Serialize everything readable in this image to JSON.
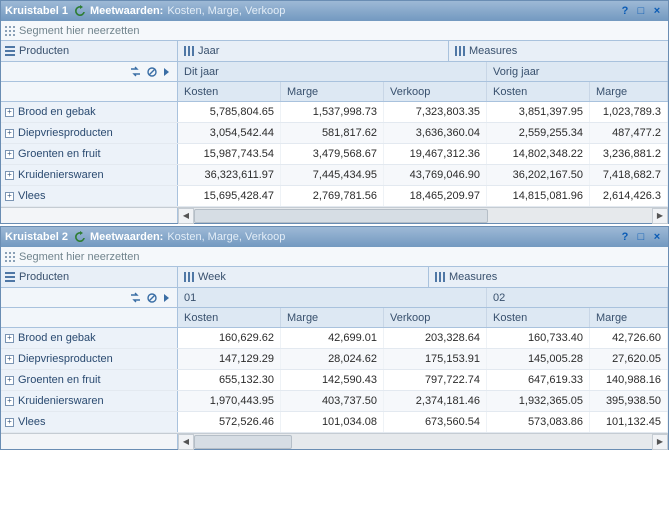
{
  "crosstab1": {
    "title": "Kruistabel 1",
    "meet_label": "Meetwaarden:",
    "meet_values": "Kosten, Marge, Verkoop",
    "segment_hint": "Segment hier neerzetten",
    "row_axis": "Producten",
    "col_axis1": "Jaar",
    "col_axis2": "Measures",
    "year1": "Dit jaar",
    "year2": "Vorig jaar",
    "cols": [
      "Kosten",
      "Marge",
      "Verkoop",
      "Kosten",
      "Marge"
    ],
    "rows": [
      {
        "label": "Brood en gebak",
        "v": [
          "5,785,804.65",
          "1,537,998.73",
          "7,323,803.35",
          "3,851,397.95",
          "1,023,789.3"
        ]
      },
      {
        "label": "Diepvriesproducten",
        "v": [
          "3,054,542.44",
          "581,817.62",
          "3,636,360.04",
          "2,559,255.34",
          "487,477.2"
        ]
      },
      {
        "label": "Groenten en fruit",
        "v": [
          "15,987,743.54",
          "3,479,568.67",
          "19,467,312.36",
          "14,802,348.22",
          "3,236,881.2"
        ]
      },
      {
        "label": "Kruidenierswaren",
        "v": [
          "36,323,611.97",
          "7,445,434.95",
          "43,769,046.90",
          "36,202,167.50",
          "7,418,682.7"
        ]
      },
      {
        "label": "Vlees",
        "v": [
          "15,695,428.47",
          "2,769,781.56",
          "18,465,209.97",
          "14,815,081.96",
          "2,614,426.3"
        ]
      }
    ]
  },
  "crosstab2": {
    "title": "Kruistabel 2",
    "meet_label": "Meetwaarden:",
    "meet_values": "Kosten, Marge, Verkoop",
    "segment_hint": "Segment hier neerzetten",
    "row_axis": "Producten",
    "col_axis1": "Week",
    "col_axis2": "Measures",
    "year1": "01",
    "year2": "02",
    "cols": [
      "Kosten",
      "Marge",
      "Verkoop",
      "Kosten",
      "Marge"
    ],
    "rows": [
      {
        "label": "Brood en gebak",
        "v": [
          "160,629.62",
          "42,699.01",
          "203,328.64",
          "160,733.40",
          "42,726.60"
        ]
      },
      {
        "label": "Diepvriesproducten",
        "v": [
          "147,129.29",
          "28,024.62",
          "175,153.91",
          "145,005.28",
          "27,620.05"
        ]
      },
      {
        "label": "Groenten en fruit",
        "v": [
          "655,132.30",
          "142,590.43",
          "797,722.74",
          "647,619.33",
          "140,988.16"
        ]
      },
      {
        "label": "Kruidenierswaren",
        "v": [
          "1,970,443.95",
          "403,737.50",
          "2,374,181.46",
          "1,932,365.05",
          "395,938.50"
        ]
      },
      {
        "label": "Vlees",
        "v": [
          "572,526.46",
          "101,034.08",
          "673,560.54",
          "573,083.86",
          "101,132.45"
        ]
      }
    ]
  }
}
